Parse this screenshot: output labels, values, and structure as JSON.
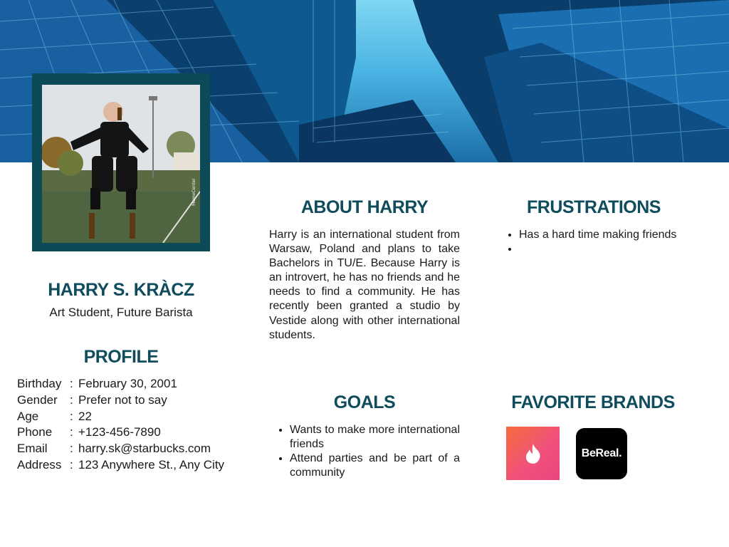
{
  "person": {
    "name": "HARRY S. KRÀCZ",
    "role": "Art Student, Future Barista"
  },
  "profile": {
    "title": "PROFILE",
    "rows": [
      {
        "key": "Birthday",
        "sep": ":",
        "value": "February 30, 2001"
      },
      {
        "key": "Gender",
        "sep": ":",
        "value": "Prefer not to say"
      },
      {
        "key": "Age",
        "sep": ":",
        "value": "22"
      },
      {
        "key": "Phone",
        "sep": ":",
        "value": "+123-456-7890"
      },
      {
        "key": "Email",
        "sep": ":",
        "value": "harry.sk@starbucks.com"
      },
      {
        "key": "Address",
        "sep": ":",
        "value": "123 Anywhere St., Any City"
      }
    ]
  },
  "about": {
    "title": "ABOUT HARRY",
    "text": "Harry is an international student from Warsaw, Poland and plans to take Bachelors in TU/E. Because Harry is an introvert, he has no friends and he needs to find a community. He has recently been granted a studio by Vestide along with other international students."
  },
  "frustrations": {
    "title": "FRUSTRATIONS",
    "items": [
      "Has a hard time making friends",
      ""
    ]
  },
  "goals": {
    "title": "GOALS",
    "items": [
      "Wants to make more international friends",
      "Attend parties and be part of a community"
    ]
  },
  "brands": {
    "title": "FAVORITE BRANDS",
    "items": [
      {
        "icon": "tinder-flame-icon",
        "label": ""
      },
      {
        "icon": "bereal-logo",
        "label": "BeReal."
      }
    ]
  },
  "photo": {
    "watermark": "MemeCenter"
  },
  "colors": {
    "accent": "#0f4c5c",
    "frame": "#0d4a57",
    "tinder_start": "#f76b3a",
    "tinder_end": "#e8457f",
    "bereal_bg": "#000000"
  }
}
